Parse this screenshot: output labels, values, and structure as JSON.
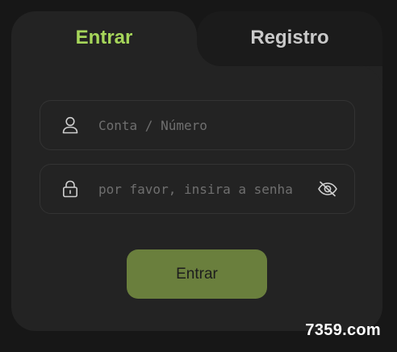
{
  "tabs": {
    "login_label": "Entrar",
    "register_label": "Registro"
  },
  "form": {
    "account_placeholder": "Conta / Número",
    "password_placeholder": "por favor, insira a senha",
    "submit_label": "Entrar"
  },
  "icons": {
    "account": "user-icon",
    "password": "lock-icon",
    "toggle_visibility": "eye-off-icon"
  },
  "colors": {
    "accent": "#a6d65a",
    "button": "#6a7f3d",
    "card": "#232323",
    "background": "#171717"
  },
  "watermark": "7359.com"
}
